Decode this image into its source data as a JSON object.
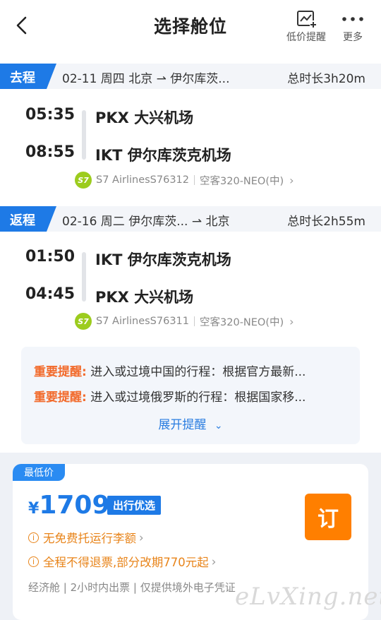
{
  "header": {
    "title": "选择舱位",
    "price_alert_label": "低价提醒",
    "more_label": "更多"
  },
  "outbound": {
    "tag": "去程",
    "info": "02-11 周四 北京 ⇀ 伊尔库茨...",
    "duration": "总时长3h20m",
    "dep_time": "05:35",
    "dep_airport": "PKX 大兴机场",
    "arr_time": "08:55",
    "arr_airport": "IKT 伊尔库茨克机场",
    "airline_logo": "S7",
    "airline": "S7 AirlinesS76312",
    "aircraft": "空客320-NEO(中)"
  },
  "return": {
    "tag": "返程",
    "info": "02-16 周二 伊尔库茨... ⇀ 北京",
    "duration": "总时长2h55m",
    "dep_time": "01:50",
    "dep_airport": "IKT 伊尔库茨克机场",
    "arr_time": "04:45",
    "arr_airport": "PKX 大兴机场",
    "airline_logo": "S7",
    "airline": "S7 AirlinesS76311",
    "aircraft": "空客320-NEO(中)"
  },
  "notices": {
    "items": [
      {
        "label": "重要提醒:",
        "text": "进入或过境中国的行程：根据官方最新..."
      },
      {
        "label": "重要提醒:",
        "text": "进入或过境俄罗斯的行程：根据国家移..."
      }
    ],
    "expand_label": "展开提醒"
  },
  "price_card": {
    "tag": "最低价",
    "currency": "¥",
    "price": "1709",
    "badge": "出行优选",
    "book_label": "订",
    "info1": "无免费托运行李额",
    "info2": "全程不得退票,部分改期770元起",
    "footer": "经济舱 | 2小时内出票 | 仅提供境外电子凭证"
  },
  "watermark": "eLvXing.net",
  "colors": {
    "accent": "#1e7ae6",
    "warning": "#f26a2b",
    "book": "#ff7f00",
    "airline_logo": "#9ccc1e"
  }
}
